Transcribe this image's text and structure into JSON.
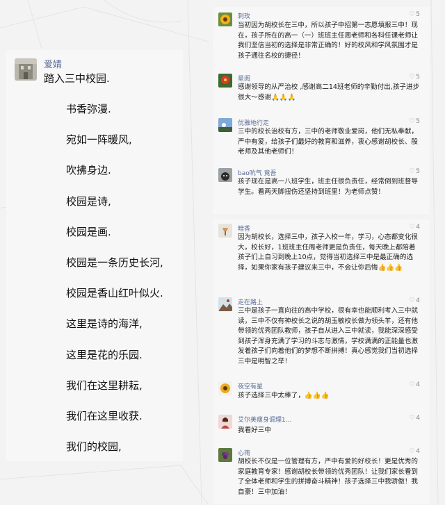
{
  "post": {
    "author": "爱婧",
    "avatar_icon": "building-avatar-icon",
    "lines": [
      "踏入三中校园.",
      "书香弥漫.",
      "宛如一阵暖风,",
      "吹拂身边.",
      "校园是诗,",
      "校园是画.",
      "校园是一条历史长河,",
      "校园是香山红叶似火.",
      "这里是诗的海洋,",
      "这里是花的乐园.",
      "我们在这里耕耘,",
      "我们在这里收获.",
      "我们的校园,"
    ]
  },
  "panel1": [
    {
      "name": "刺玫",
      "likes": "5",
      "avatar_icon": "sunflower-avatar-icon",
      "text": "当初因为胡校长在三中，所以孩子中招第一志愿填报三中！现在，孩子所在的高一（一）班班主任周老师和各科任课老师让我们坚信当初的选择是非常正确的！好的校风和学风氛围才是孩子通往名校的捷径！"
    },
    {
      "name": "星阅",
      "likes": "5",
      "avatar_icon": "red-flower-avatar-icon",
      "text": "感谢领导的从严治校 ,感谢高二14班老师的辛勤付出,孩子进步很大～感谢🙏🙏🙏"
    },
    {
      "name": "优雅地行走",
      "likes": "5",
      "avatar_icon": "blue-sky-avatar-icon",
      "text": "三中的校长治校有方，三中的老师敬业爱岗，他们无私奉献，严中有爱，给孩子们最好的教育和滋养，衷心感谢胡校长、殷老师及其他老师们！"
    },
    {
      "name": "bao吭气 竟吾",
      "likes": "5",
      "avatar_icon": "dog-avatar-icon",
      "text": "孩子现在是高一八班学生，班主任很负责任，经常倒到班督导学生。看两天脚扭伤还坚持到班里！为老师点赞！"
    }
  ],
  "panel2": [
    {
      "name": "暗香",
      "likes": "4",
      "avatar_icon": "lamp-avatar-icon",
      "text": "因为胡校长，选择三中，孩子入校一年，学习，心态都变化很大，校长好，1班班主任周老师更是负责任，每天晚上都陪着孩子们上自习到晚上10点，觉得当初选择三中是最正确的选择，如果你家有孩子建议来三中，不会让你后悔👍👍👍"
    },
    {
      "name": "走在路上",
      "likes": "4",
      "avatar_icon": "mountain-avatar-icon",
      "text": "三中是孩子一直向往的高中学校，很有幸也能顺利考入三中就读，三中不仅有神校长之说的胡玉敏校长做为领头羊，还有他带领的优秀团队教师，孩子自从进入三中就读，我能深深感受到孩子浑身充满了学习的斗志与激情，学校满满的正能量也激发着孩子们向着他们的梦想不断拼搏！真心感觉我们当初选择三中是明智之举！"
    },
    {
      "name": "夜空有星",
      "likes": "4",
      "avatar_icon": "sunflower-avatar-icon",
      "text": "孩子选择三中太棒了，👍👍👍"
    },
    {
      "name": "艾尔美瘦身调理1...",
      "likes": "4",
      "avatar_icon": "woman-avatar-icon",
      "text": "我看好三中"
    },
    {
      "name": "心雨",
      "likes": "4",
      "avatar_icon": "grape-avatar-icon",
      "text": "胡校长不仅是一位管理有方，严中有爱的好校长！更是优秀的家庭教育专家！感谢胡校长带领的优秀团队！让我们家长看到了全体老师和学生的拼搏奋斗精神！孩子选择三中我骄傲！我自豪！三中加油！"
    }
  ]
}
